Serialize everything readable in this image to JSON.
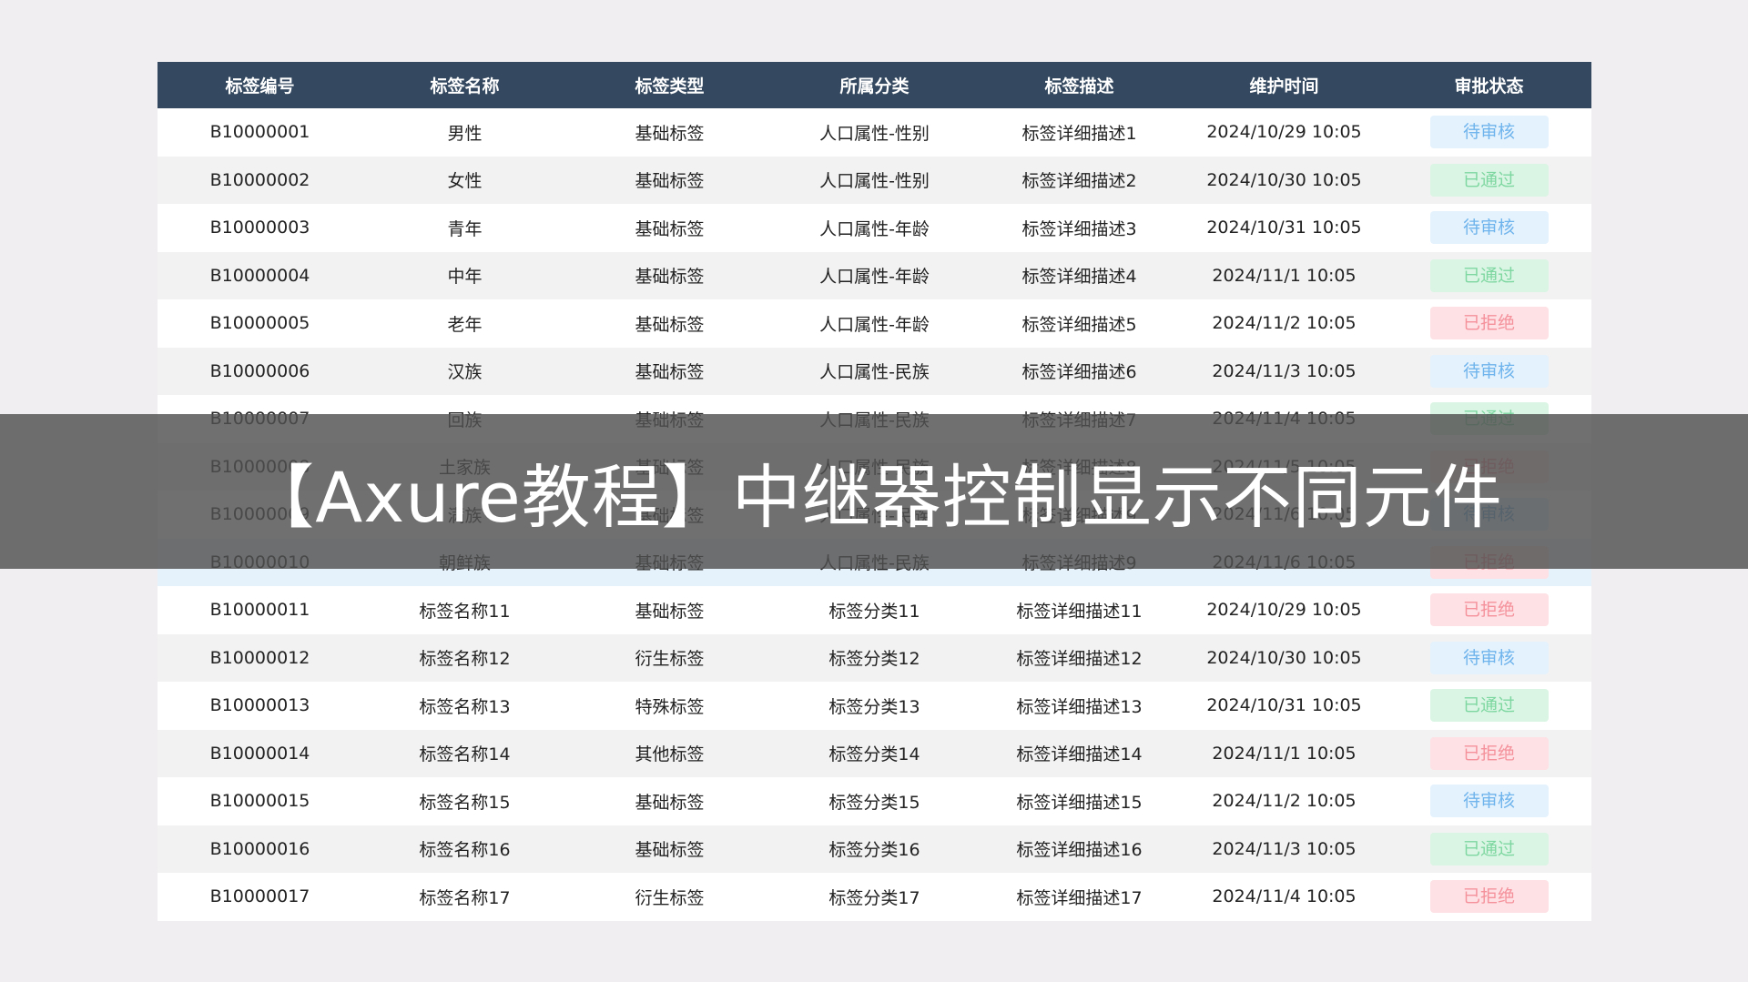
{
  "table": {
    "columns": [
      "标签编号",
      "标签名称",
      "标签类型",
      "所属分类",
      "标签描述",
      "维护时间",
      "审批状态"
    ],
    "rows": [
      {
        "id": "B10000001",
        "name": "男性",
        "type": "基础标签",
        "category": "人口属性-性别",
        "desc": "标签详细描述1",
        "time": "2024/10/29 10:05",
        "status": "待审核",
        "status_kind": "pending"
      },
      {
        "id": "B10000002",
        "name": "女性",
        "type": "基础标签",
        "category": "人口属性-性别",
        "desc": "标签详细描述2",
        "time": "2024/10/30 10:05",
        "status": "已通过",
        "status_kind": "approved"
      },
      {
        "id": "B10000003",
        "name": "青年",
        "type": "基础标签",
        "category": "人口属性-年龄",
        "desc": "标签详细描述3",
        "time": "2024/10/31 10:05",
        "status": "待审核",
        "status_kind": "pending"
      },
      {
        "id": "B10000004",
        "name": "中年",
        "type": "基础标签",
        "category": "人口属性-年龄",
        "desc": "标签详细描述4",
        "time": "2024/11/1 10:05",
        "status": "已通过",
        "status_kind": "approved"
      },
      {
        "id": "B10000005",
        "name": "老年",
        "type": "基础标签",
        "category": "人口属性-年龄",
        "desc": "标签详细描述5",
        "time": "2024/11/2 10:05",
        "status": "已拒绝",
        "status_kind": "rejected"
      },
      {
        "id": "B10000006",
        "name": "汉族",
        "type": "基础标签",
        "category": "人口属性-民族",
        "desc": "标签详细描述6",
        "time": "2024/11/3 10:05",
        "status": "待审核",
        "status_kind": "pending"
      },
      {
        "id": "B10000007",
        "name": "回族",
        "type": "基础标签",
        "category": "人口属性-民族",
        "desc": "标签详细描述7",
        "time": "2024/11/4 10:05",
        "status": "已通过",
        "status_kind": "approved"
      },
      {
        "id": "B10000008",
        "name": "土家族",
        "type": "基础标签",
        "category": "人口属性-民族",
        "desc": "标签详细描述8",
        "time": "2024/11/5 10:05",
        "status": "已拒绝",
        "status_kind": "rejected"
      },
      {
        "id": "B10000009",
        "name": "满族",
        "type": "基础标签",
        "category": "人口属性-民族",
        "desc": "标签详细描述9",
        "time": "2024/11/6 10:05",
        "status": "待审核",
        "status_kind": "pending"
      },
      {
        "id": "B10000010",
        "name": "朝鲜族",
        "type": "基础标签",
        "category": "人口属性-民族",
        "desc": "标签详细描述9",
        "time": "2024/11/6 10:05",
        "status": "已拒绝",
        "status_kind": "rejected"
      },
      {
        "id": "B10000011",
        "name": "标签名称11",
        "type": "基础标签",
        "category": "标签分类11",
        "desc": "标签详细描述11",
        "time": "2024/10/29 10:05",
        "status": "已拒绝",
        "status_kind": "rejected"
      },
      {
        "id": "B10000012",
        "name": "标签名称12",
        "type": "衍生标签",
        "category": "标签分类12",
        "desc": "标签详细描述12",
        "time": "2024/10/30 10:05",
        "status": "待审核",
        "status_kind": "pending"
      },
      {
        "id": "B10000013",
        "name": "标签名称13",
        "type": "特殊标签",
        "category": "标签分类13",
        "desc": "标签详细描述13",
        "time": "2024/10/31 10:05",
        "status": "已通过",
        "status_kind": "approved"
      },
      {
        "id": "B10000014",
        "name": "标签名称14",
        "type": "其他标签",
        "category": "标签分类14",
        "desc": "标签详细描述14",
        "time": "2024/11/1 10:05",
        "status": "已拒绝",
        "status_kind": "rejected"
      },
      {
        "id": "B10000015",
        "name": "标签名称15",
        "type": "基础标签",
        "category": "标签分类15",
        "desc": "标签详细描述15",
        "time": "2024/11/2 10:05",
        "status": "待审核",
        "status_kind": "pending"
      },
      {
        "id": "B10000016",
        "name": "标签名称16",
        "type": "基础标签",
        "category": "标签分类16",
        "desc": "标签详细描述16",
        "time": "2024/11/3 10:05",
        "status": "已通过",
        "status_kind": "approved"
      },
      {
        "id": "B10000017",
        "name": "标签名称17",
        "type": "衍生标签",
        "category": "标签分类17",
        "desc": "标签详细描述17",
        "time": "2024/11/4 10:05",
        "status": "已拒绝",
        "status_kind": "rejected"
      }
    ]
  },
  "banner": {
    "title": "【Axure教程】中继器控制显示不同元件"
  },
  "colors": {
    "background": "#f1eef2",
    "header": "#344960",
    "pending_bg": "#e4f2fd",
    "pending_text": "#6fb4ec",
    "approved_bg": "#daf5e4",
    "approved_text": "#7ed7a0",
    "rejected_bg": "#fde1e4",
    "rejected_text": "#f5919b",
    "highlight_row": "#e6f2fb"
  }
}
